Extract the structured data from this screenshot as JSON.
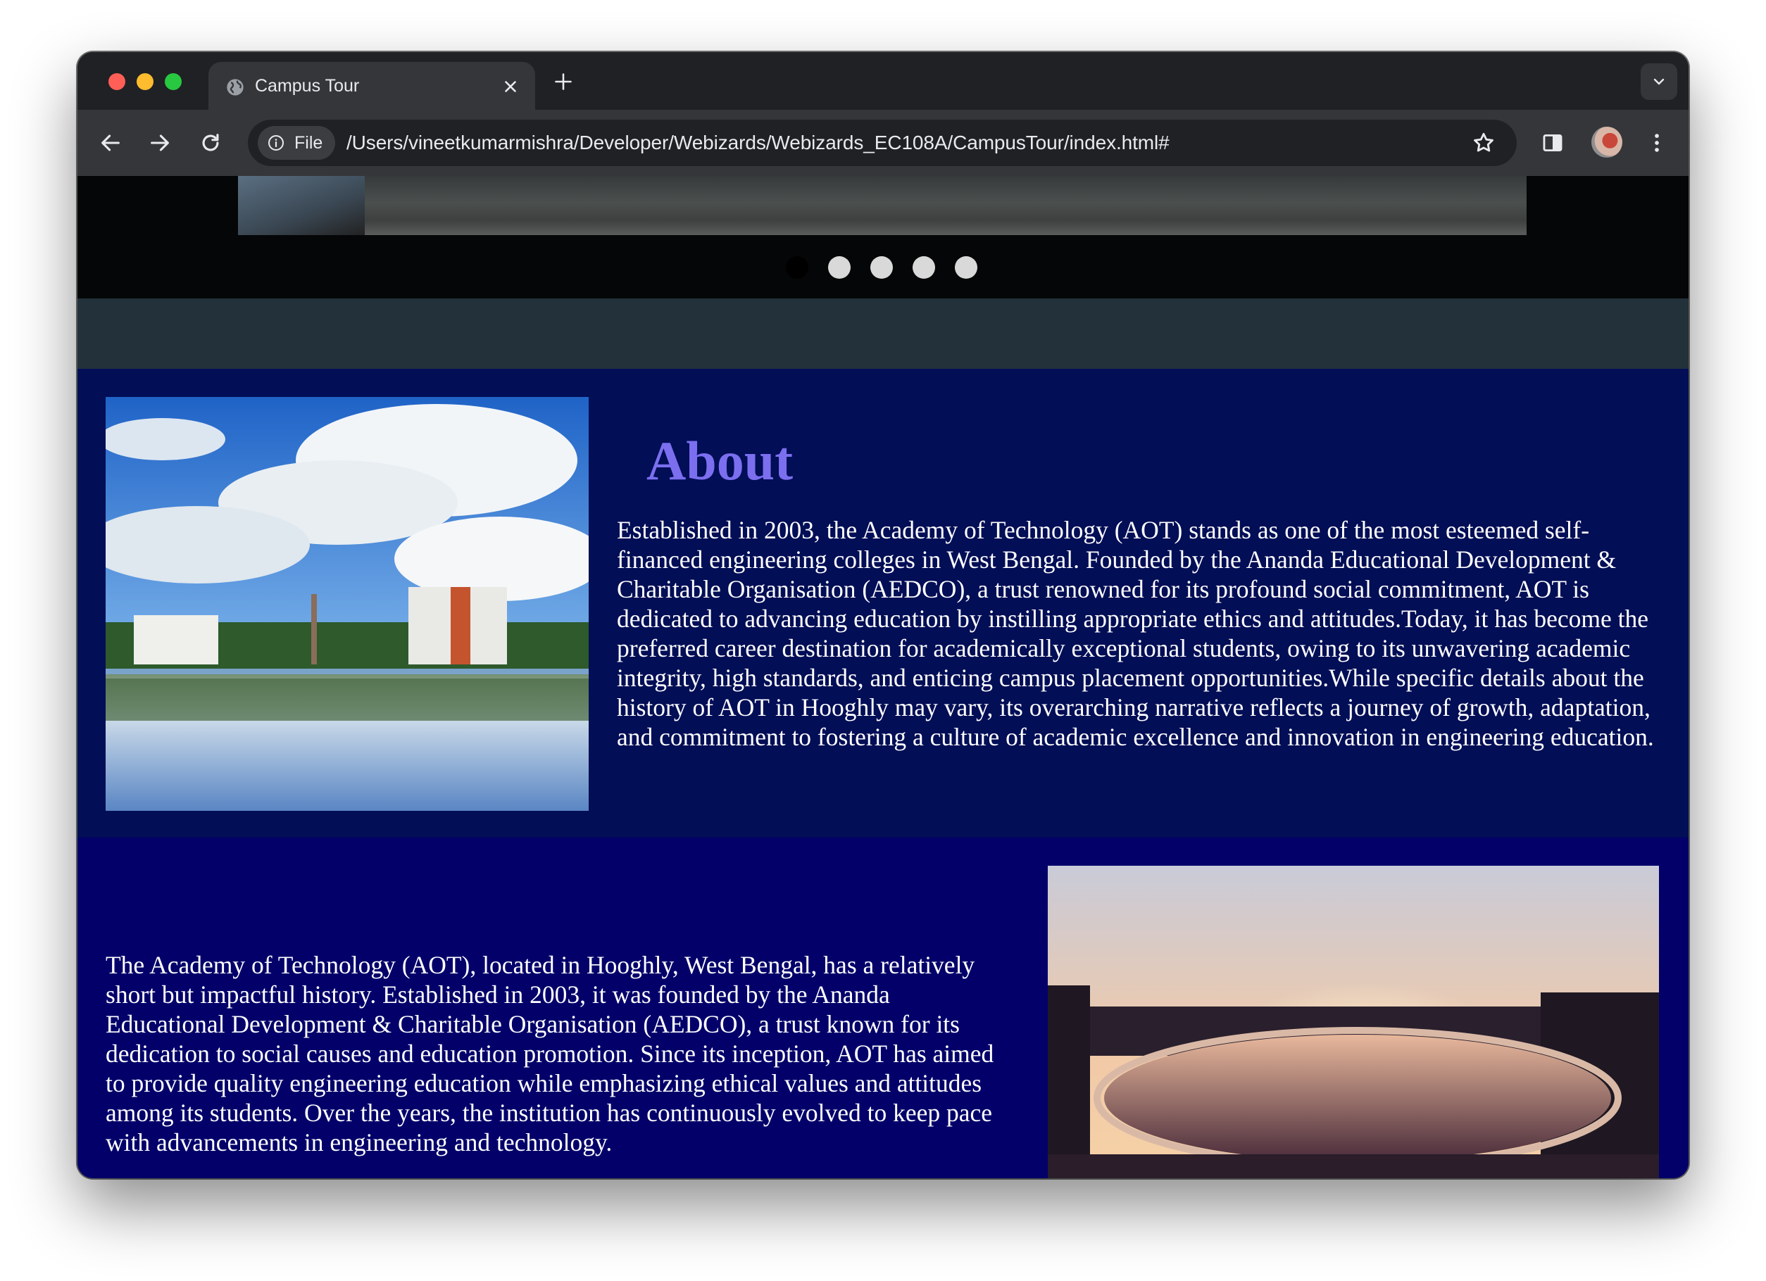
{
  "browser": {
    "tab_title": "Campus Tour",
    "address_chip": "File",
    "url": "/Users/vineetkumarmishra/Developer/Webizards/Webizards_EC108A/CampusTour/index.html#"
  },
  "carousel": {
    "slide_count": 5,
    "active_index": 0
  },
  "about": {
    "title": "About",
    "text": "Established in 2003, the Academy of Technology (AOT) stands as one of the most esteemed self-financed engineering colleges in West Bengal. Founded by the Ananda Educational Development & Charitable Organisation (AEDCO), a trust renowned for its profound social commitment, AOT is dedicated to advancing education by instilling appropriate ethics and attitudes.Today, it has become the preferred career destination for academically exceptional students, owing to its unwavering academic integrity, high standards, and enticing campus placement opportunities.While specific details about the history of AOT in Hooghly may vary, its overarching narrative reflects a journey of growth, adaptation, and commitment to fostering a culture of academic excellence and innovation in engineering education."
  },
  "history": {
    "text": "The Academy of Technology (AOT), located in Hooghly, West Bengal, has a relatively short but impactful history. Established in 2003, it was founded by the Ananda Educational Development & Charitable Organisation (AEDCO), a trust known for its dedication to social causes and education promotion. Since its inception, AOT has aimed to provide quality engineering education while emphasizing ethical values and attitudes among its students. Over the years, the institution has continuously evolved to keep pace with advancements in engineering and technology."
  },
  "colors": {
    "about_bg": "#020e56",
    "history_bg": "#03006a",
    "about_title": "#7b6ff0"
  }
}
